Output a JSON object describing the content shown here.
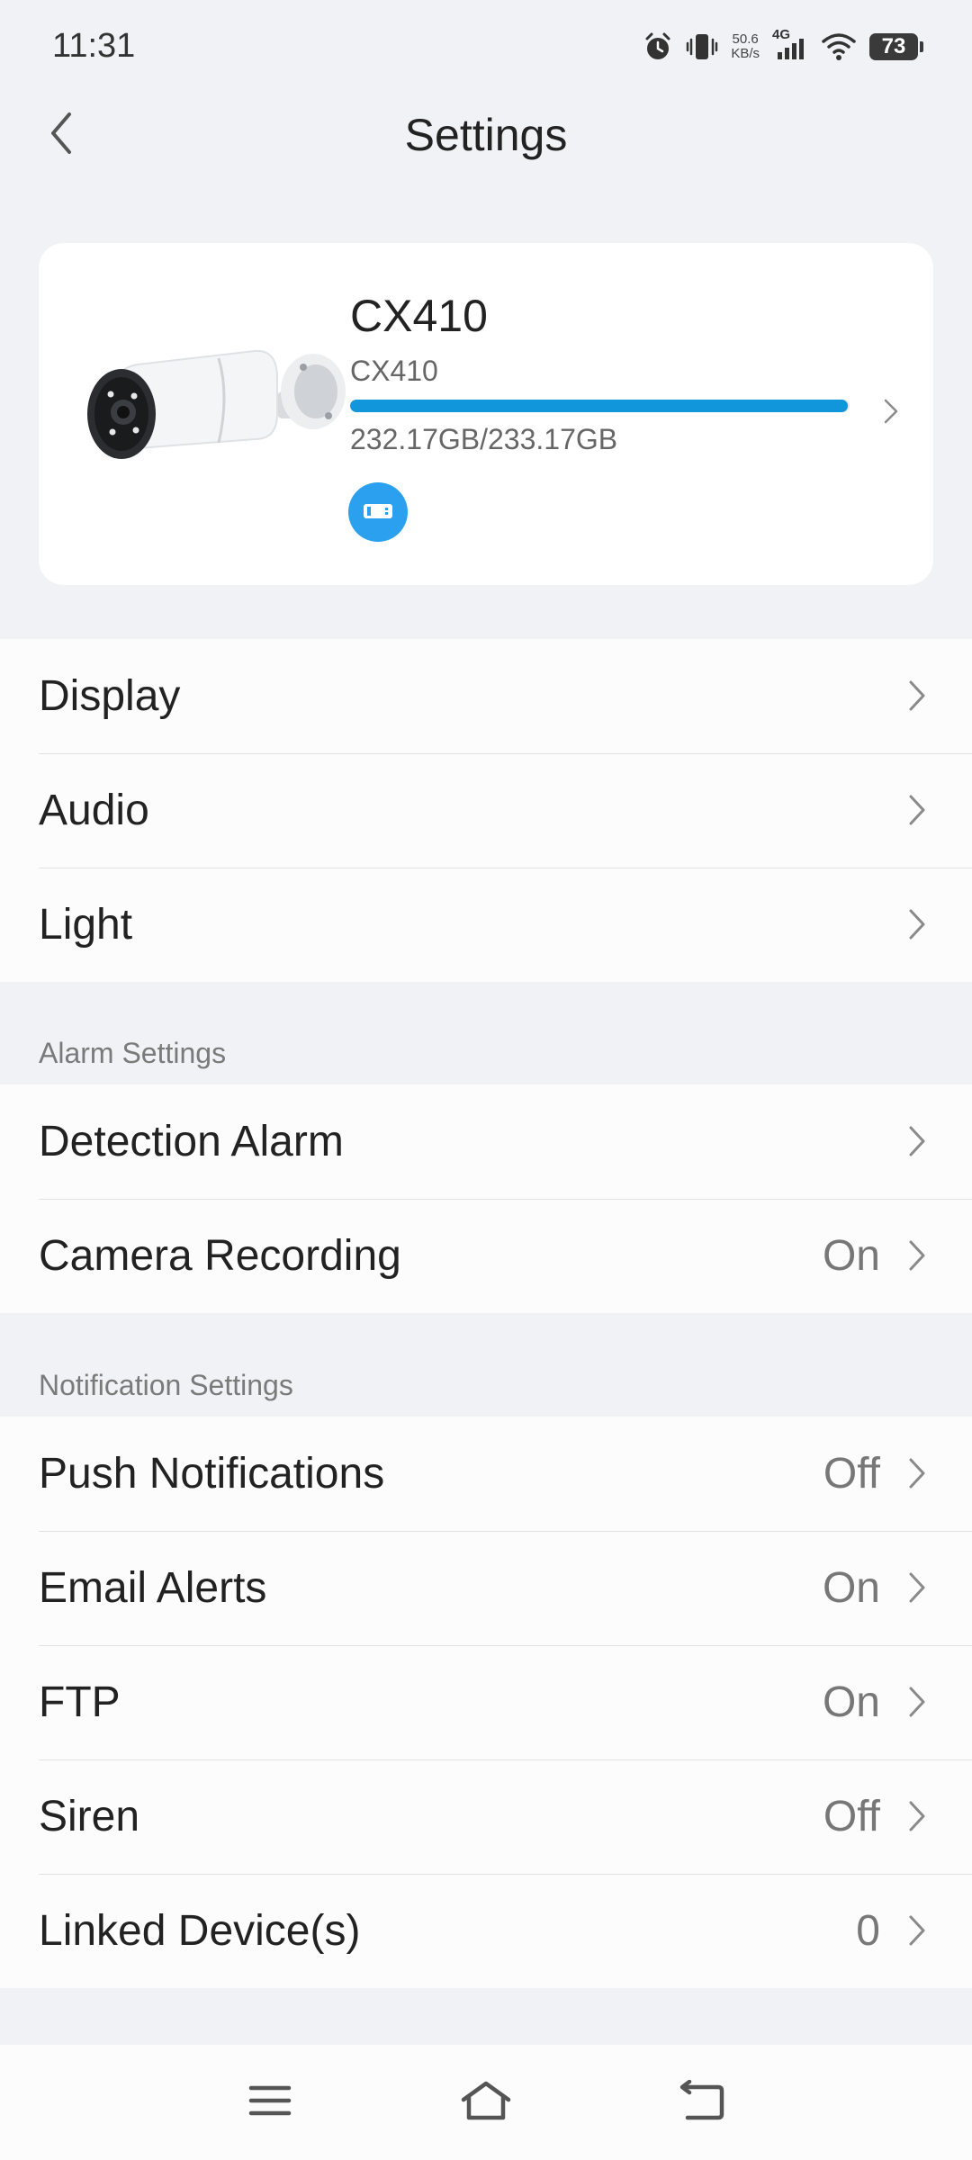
{
  "status_bar": {
    "time": "11:31",
    "net_speed_value": "50.6",
    "net_speed_unit": "KB/s",
    "network_type": "4G",
    "battery": "73",
    "icons": [
      "alarm-icon",
      "vibrate-icon",
      "signal-icon",
      "wifi-icon",
      "battery-icon"
    ]
  },
  "header": {
    "title": "Settings",
    "back_icon": "chevron-left-icon"
  },
  "device": {
    "name": "CX410",
    "model": "CX410",
    "storage_text": "232.17GB/233.17GB",
    "storage_used_fraction": 0.9957,
    "badge_icon": "sd-card-icon",
    "accent_color": "#1296db"
  },
  "general_items": [
    {
      "label": "Display",
      "value": ""
    },
    {
      "label": "Audio",
      "value": ""
    },
    {
      "label": "Light",
      "value": ""
    }
  ],
  "alarm_section": {
    "title": "Alarm Settings",
    "items": [
      {
        "label": "Detection Alarm",
        "value": ""
      },
      {
        "label": "Camera Recording",
        "value": "On"
      }
    ]
  },
  "notification_section": {
    "title": "Notification Settings",
    "items": [
      {
        "label": "Push Notifications",
        "value": "Off"
      },
      {
        "label": "Email Alerts",
        "value": "On"
      },
      {
        "label": "FTP",
        "value": "On"
      },
      {
        "label": "Siren",
        "value": "Off"
      },
      {
        "label": "Linked Device(s)",
        "value": "0"
      }
    ]
  },
  "bottom_nav": {
    "icons": [
      "menu-icon",
      "home-icon",
      "back-icon"
    ]
  }
}
